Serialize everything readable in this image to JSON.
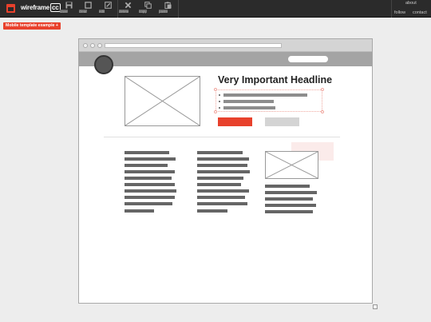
{
  "toolbar": {
    "brand": "wireframe",
    "brand_suffix": "cc",
    "tools": [
      {
        "label": "save",
        "icon": "floppy-icon"
      },
      {
        "label": "clear",
        "icon": "square-icon"
      },
      {
        "label": "edit",
        "icon": "pencil-icon"
      },
      {
        "label": "delete",
        "icon": "x-icon"
      },
      {
        "label": "copy",
        "icon": "copy-icon"
      },
      {
        "label": "paste",
        "icon": "paste-icon"
      }
    ],
    "links": {
      "about": "about",
      "follow": "follow",
      "contact": "contact"
    }
  },
  "template_tag": "Mobile template example +",
  "canvas": {
    "headline": "Very Important Headline",
    "bullet_count": 3,
    "accent_color": "#e8412c",
    "secondary_button_color": "#d4d4d4"
  }
}
